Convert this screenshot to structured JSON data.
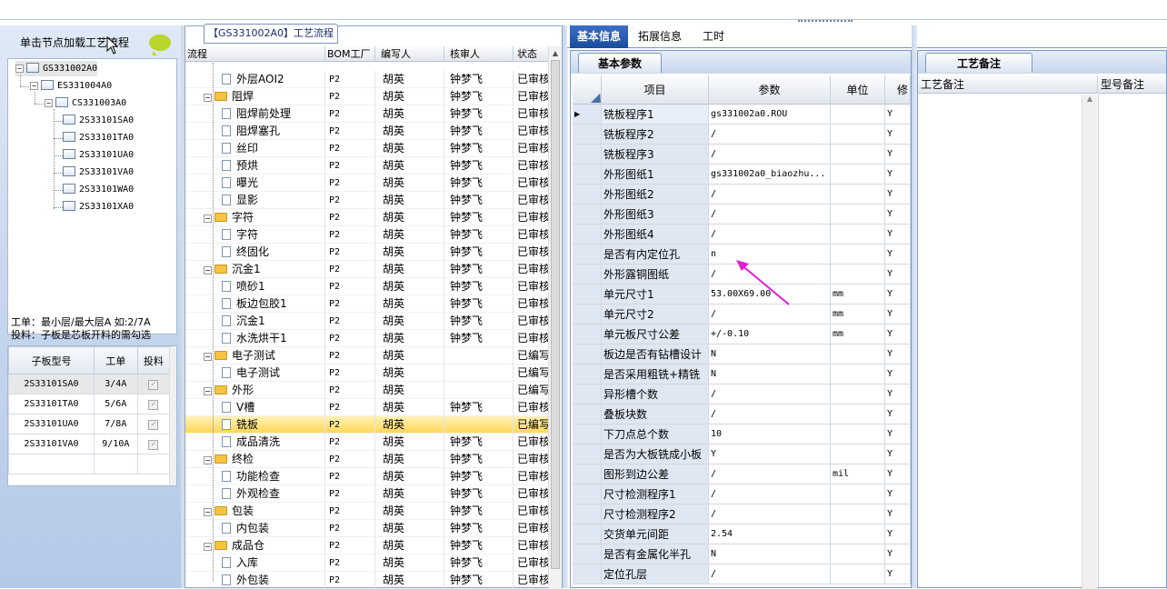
{
  "process_title": "【GS331002A0】工艺流程",
  "left_panel": {
    "header": "单击节点加载工艺流程",
    "tree": [
      {
        "label": "GS331002A0",
        "level": 0,
        "selected": true
      },
      {
        "label": "ES331004A0",
        "level": 1
      },
      {
        "label": "CS331003A0",
        "level": 2
      },
      {
        "label": "2S33101SA0",
        "level": 3
      },
      {
        "label": "2S33101TA0",
        "level": 3
      },
      {
        "label": "2S33101UA0",
        "level": 3
      },
      {
        "label": "2S33101VA0",
        "level": 3
      },
      {
        "label": "2S33101WA0",
        "level": 3
      },
      {
        "label": "2S33101XA0",
        "level": 3
      }
    ],
    "note_line1": "工单：最小层/最大层A 如:2/7A",
    "note_line2": "投料：子板是芯板开料的需勾选",
    "mini_table": {
      "headers": [
        "子板型号",
        "工单",
        "投料"
      ],
      "rows": [
        {
          "model": "2S33101SA0",
          "order": "3/4A",
          "checked": true
        },
        {
          "model": "2S33101TA0",
          "order": "5/6A",
          "checked": true
        },
        {
          "model": "2S33101UA0",
          "order": "7/8A",
          "checked": true
        },
        {
          "model": "2S33101VA0",
          "order": "9/10A",
          "checked": true
        }
      ]
    }
  },
  "middle_panel": {
    "headers": [
      "流程",
      "BOM工厂",
      "编写人",
      "核审人",
      "状态"
    ],
    "rows": [
      {
        "name": "外层AOI2",
        "type": "doc",
        "bom": "P2",
        "writer": "胡英",
        "reviewer": "钟梦飞",
        "status": "已审核"
      },
      {
        "name": "阻焊",
        "type": "folder",
        "bom": "P2",
        "writer": "胡英",
        "reviewer": "钟梦飞",
        "status": "已审核"
      },
      {
        "name": "阻焊前处理",
        "type": "doc",
        "bom": "P2",
        "writer": "胡英",
        "reviewer": "钟梦飞",
        "status": "已审核"
      },
      {
        "name": "阻焊塞孔",
        "type": "doc",
        "bom": "P2",
        "writer": "胡英",
        "reviewer": "钟梦飞",
        "status": "已审核"
      },
      {
        "name": "丝印",
        "type": "doc",
        "bom": "P2",
        "writer": "胡英",
        "reviewer": "钟梦飞",
        "status": "已审核"
      },
      {
        "name": "预烘",
        "type": "doc",
        "bom": "P2",
        "writer": "胡英",
        "reviewer": "钟梦飞",
        "status": "已审核"
      },
      {
        "name": "曝光",
        "type": "doc",
        "bom": "P2",
        "writer": "胡英",
        "reviewer": "钟梦飞",
        "status": "已审核"
      },
      {
        "name": "显影",
        "type": "doc",
        "bom": "P2",
        "writer": "胡英",
        "reviewer": "钟梦飞",
        "status": "已审核"
      },
      {
        "name": "字符",
        "type": "folder",
        "bom": "P2",
        "writer": "胡英",
        "reviewer": "钟梦飞",
        "status": "已审核"
      },
      {
        "name": "字符",
        "type": "doc",
        "bom": "P2",
        "writer": "胡英",
        "reviewer": "钟梦飞",
        "status": "已审核"
      },
      {
        "name": "终固化",
        "type": "doc",
        "bom": "P2",
        "writer": "胡英",
        "reviewer": "钟梦飞",
        "status": "已审核"
      },
      {
        "name": "沉金1",
        "type": "folder",
        "bom": "P2",
        "writer": "胡英",
        "reviewer": "钟梦飞",
        "status": "已审核"
      },
      {
        "name": "喷砂1",
        "type": "doc",
        "bom": "P2",
        "writer": "胡英",
        "reviewer": "钟梦飞",
        "status": "已审核"
      },
      {
        "name": "板边包胶1",
        "type": "doc",
        "bom": "P2",
        "writer": "胡英",
        "reviewer": "钟梦飞",
        "status": "已审核"
      },
      {
        "name": "沉金1",
        "type": "doc",
        "bom": "P2",
        "writer": "胡英",
        "reviewer": "钟梦飞",
        "status": "已审核"
      },
      {
        "name": "水洗烘干1",
        "type": "doc",
        "bom": "P2",
        "writer": "胡英",
        "reviewer": "钟梦飞",
        "status": "已审核"
      },
      {
        "name": "电子测试",
        "type": "folder",
        "bom": "P2",
        "writer": "胡英",
        "reviewer": "",
        "status": "已编写"
      },
      {
        "name": "电子测试",
        "type": "doc",
        "bom": "P2",
        "writer": "胡英",
        "reviewer": "",
        "status": "已编写"
      },
      {
        "name": "外形",
        "type": "folder",
        "bom": "P2",
        "writer": "胡英",
        "reviewer": "",
        "status": "已编写"
      },
      {
        "name": "V槽",
        "type": "doc",
        "bom": "P2",
        "writer": "胡英",
        "reviewer": "钟梦飞",
        "status": "已审核"
      },
      {
        "name": "铣板",
        "type": "doc",
        "bom": "P2",
        "writer": "胡英",
        "reviewer": "",
        "status": "已编写",
        "selected": true
      },
      {
        "name": "成品清洗",
        "type": "doc",
        "bom": "P2",
        "writer": "胡英",
        "reviewer": "钟梦飞",
        "status": "已审核"
      },
      {
        "name": "终检",
        "type": "folder",
        "bom": "P2",
        "writer": "胡英",
        "reviewer": "钟梦飞",
        "status": "已审核"
      },
      {
        "name": "功能检查",
        "type": "doc",
        "bom": "P2",
        "writer": "胡英",
        "reviewer": "钟梦飞",
        "status": "已审核"
      },
      {
        "name": "外观检查",
        "type": "doc",
        "bom": "P2",
        "writer": "胡英",
        "reviewer": "钟梦飞",
        "status": "已审核"
      },
      {
        "name": "包装",
        "type": "folder",
        "bom": "P2",
        "writer": "胡英",
        "reviewer": "钟梦飞",
        "status": "已审核"
      },
      {
        "name": "内包装",
        "type": "doc",
        "bom": "P2",
        "writer": "胡英",
        "reviewer": "钟梦飞",
        "status": "已审核"
      },
      {
        "name": "成品仓",
        "type": "folder",
        "bom": "P2",
        "writer": "胡英",
        "reviewer": "钟梦飞",
        "status": "已审核"
      },
      {
        "name": "入库",
        "type": "doc",
        "bom": "P2",
        "writer": "胡英",
        "reviewer": "钟梦飞",
        "status": "已审核"
      },
      {
        "name": "外包装",
        "type": "doc",
        "bom": "P2",
        "writer": "胡英",
        "reviewer": "钟梦飞",
        "status": "已审核"
      }
    ]
  },
  "right_tabs": [
    "基本信息",
    "拓展信息",
    "工时"
  ],
  "param_panel": {
    "tab": "基本参数",
    "headers": [
      "项目",
      "参数",
      "单位",
      "修"
    ],
    "rows": [
      {
        "item": "铣板程序1",
        "value": "gs331002a0.ROU",
        "unit": "",
        "flag": "Y"
      },
      {
        "item": "铣板程序2",
        "value": "/",
        "unit": "",
        "flag": "Y"
      },
      {
        "item": "铣板程序3",
        "value": "/",
        "unit": "",
        "flag": "Y"
      },
      {
        "item": "外形图纸1",
        "value": "gs331002a0_biaozhu...",
        "unit": "",
        "flag": "Y"
      },
      {
        "item": "外形图纸2",
        "value": "/",
        "unit": "",
        "flag": "Y"
      },
      {
        "item": "外形图纸3",
        "value": "/",
        "unit": "",
        "flag": "Y"
      },
      {
        "item": "外形图纸4",
        "value": "/",
        "unit": "",
        "flag": "Y"
      },
      {
        "item": "是否有内定位孔",
        "value": "n",
        "unit": "",
        "flag": "Y"
      },
      {
        "item": "外形露铜图纸",
        "value": "/",
        "unit": "",
        "flag": "Y"
      },
      {
        "item": "单元尺寸1",
        "value": "53.00X69.00",
        "unit": "mm",
        "flag": "Y"
      },
      {
        "item": "单元尺寸2",
        "value": "/",
        "unit": "mm",
        "flag": "Y"
      },
      {
        "item": "单元板尺寸公差",
        "value": "+/-0.10",
        "unit": "mm",
        "flag": "Y"
      },
      {
        "item": "板边是否有钻槽设计",
        "value": "N",
        "unit": "",
        "flag": "Y"
      },
      {
        "item": "是否采用粗铣+精铣",
        "value": "N",
        "unit": "",
        "flag": "Y"
      },
      {
        "item": "异形槽个数",
        "value": "/",
        "unit": "",
        "flag": "Y"
      },
      {
        "item": "叠板块数",
        "value": "/",
        "unit": "",
        "flag": "Y"
      },
      {
        "item": "下刀点总个数",
        "value": "10",
        "unit": "",
        "flag": "Y"
      },
      {
        "item": "是否为大板铣成小板",
        "value": "Y",
        "unit": "",
        "flag": "Y"
      },
      {
        "item": "图形到边公差",
        "value": "/",
        "unit": "mil",
        "flag": "Y"
      },
      {
        "item": "尺寸检测程序1",
        "value": "/",
        "unit": "",
        "flag": "Y"
      },
      {
        "item": "尺寸检测程序2",
        "value": "/",
        "unit": "",
        "flag": "Y"
      },
      {
        "item": "交货单元间距",
        "value": "2.54",
        "unit": "",
        "flag": "Y"
      },
      {
        "item": "是否有金属化半孔",
        "value": "N",
        "unit": "",
        "flag": "Y"
      },
      {
        "item": "定位孔层",
        "value": "/",
        "unit": "",
        "flag": "Y"
      }
    ]
  },
  "notes_panel": {
    "tab": "工艺备注",
    "headers": [
      "工艺备注",
      "型号备注"
    ]
  },
  "colors": {
    "accent": "#1b4c9c",
    "annotation_arrow": "#e21bd6",
    "selection": "#ffd75a"
  }
}
